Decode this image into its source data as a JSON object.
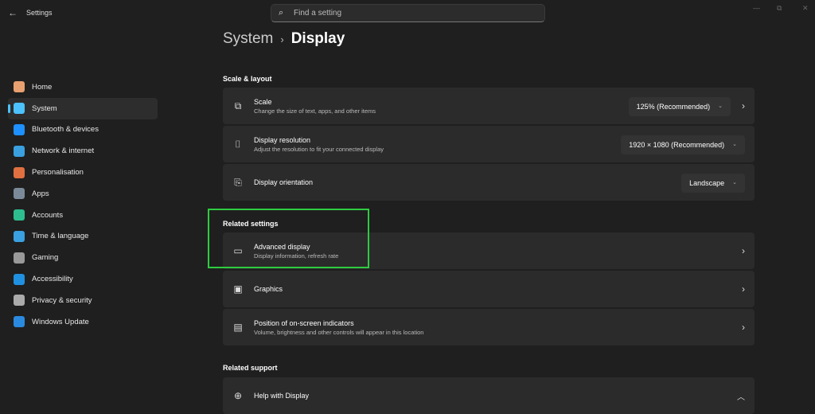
{
  "app": {
    "title": "Settings",
    "back": "←"
  },
  "search": {
    "placeholder": "Find a setting"
  },
  "window": {
    "minimize": "—",
    "maximize": "⧉",
    "close": "✕"
  },
  "sidebar": {
    "items": [
      {
        "label": "Home",
        "color": "#e8a070"
      },
      {
        "label": "System",
        "color": "#4cc2ff"
      },
      {
        "label": "Bluetooth & devices",
        "color": "#1e90ff"
      },
      {
        "label": "Network & internet",
        "color": "#3aa0e0"
      },
      {
        "label": "Personalisation",
        "color": "#e07040"
      },
      {
        "label": "Apps",
        "color": "#7a8a99"
      },
      {
        "label": "Accounts",
        "color": "#2ebd8f"
      },
      {
        "label": "Time & language",
        "color": "#3aa0e0"
      },
      {
        "label": "Gaming",
        "color": "#999"
      },
      {
        "label": "Accessibility",
        "color": "#2090e0"
      },
      {
        "label": "Privacy & security",
        "color": "#aaa"
      },
      {
        "label": "Windows Update",
        "color": "#2a8ae0"
      }
    ]
  },
  "breadcrumb": {
    "parent": "System",
    "sep": "›",
    "current": "Display"
  },
  "sections": {
    "scale": "Scale & layout",
    "related": "Related settings",
    "support": "Related support"
  },
  "cards": {
    "scale": {
      "title": "Scale",
      "sub": "Change the size of text, apps, and other items",
      "value": "125% (Recommended)"
    },
    "resolution": {
      "title": "Display resolution",
      "sub": "Adjust the resolution to fit your connected display",
      "value": "1920 × 1080 (Recommended)"
    },
    "orientation": {
      "title": "Display orientation",
      "value": "Landscape"
    },
    "advanced": {
      "title": "Advanced display",
      "sub": "Display information, refresh rate"
    },
    "graphics": {
      "title": "Graphics"
    },
    "indicators": {
      "title": "Position of on-screen indicators",
      "sub": "Volume, brightness and other controls will appear in this location"
    },
    "help": {
      "title": "Help with Display"
    }
  }
}
